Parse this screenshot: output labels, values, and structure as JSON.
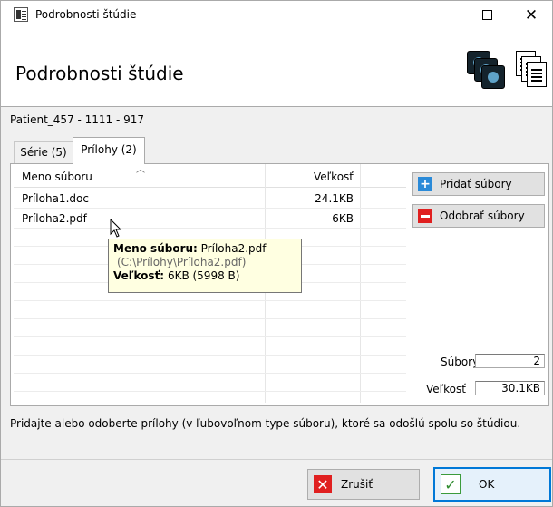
{
  "window": {
    "title": "Podrobnosti štúdie",
    "minimize_icon": "minimize-icon",
    "maximize_icon": "maximize-icon",
    "close_glyph": "✕"
  },
  "header": {
    "title": "Podrobnosti štúdie",
    "icons": [
      "image-stack-icon",
      "documents-icon"
    ]
  },
  "patient_line": "Patient_457 - 1111 - 917",
  "tabs": [
    {
      "label": "Série (5)",
      "active": false
    },
    {
      "label": "Prílohy (2)",
      "active": true
    }
  ],
  "table": {
    "columns": [
      "Meno súboru",
      "Veľkosť"
    ],
    "rows": [
      {
        "name": "Príloha1.doc",
        "size": "24.1KB"
      },
      {
        "name": "Príloha2.pdf",
        "size": "6KB"
      }
    ]
  },
  "buttons": {
    "add": "Pridať súbory",
    "remove": "Odobrať súbory",
    "cancel": "Zrušiť",
    "ok": "OK"
  },
  "stats": {
    "files_label": "Súbory",
    "files_value": "2",
    "size_label": "Veľkosť",
    "size_value": "30.1KB"
  },
  "tooltip": {
    "name_label": "Meno súboru:",
    "name_value": "Príloha2.pdf",
    "path": "(C:\\Prílohy\\Príloha2.pdf)",
    "size_label": "Veľkosť:",
    "size_value": "6KB (5998 B)"
  },
  "hint": "Pridajte alebo odoberte prílohy (v ľubovoľnom type súboru), ktoré sa odošlú spolu so štúdiou.",
  "colors": {
    "accent": "#0078d7",
    "add_icon": "#2a8ad8",
    "remove_icon": "#e02020",
    "tooltip_bg": "#ffffe1"
  }
}
